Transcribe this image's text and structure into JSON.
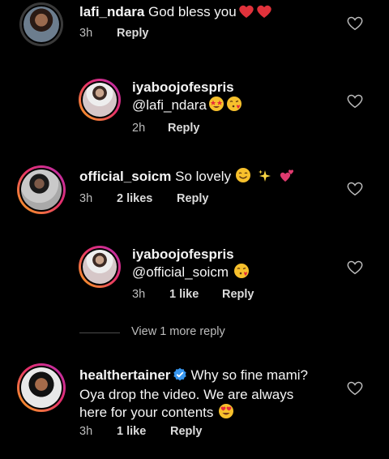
{
  "comments": [
    {
      "username": "lafi_ndara",
      "text": "God bless you",
      "emojis": [
        "red-heart",
        "red-heart"
      ],
      "time": "3h",
      "likes": "",
      "reply_label": "Reply"
    },
    {
      "username": "iyaboojofespris",
      "text": "@lafi_ndara",
      "emojis": [
        "star-struck",
        "face-blowing-kiss"
      ],
      "time": "2h",
      "likes": "",
      "reply_label": "Reply"
    },
    {
      "username": "official_soicm",
      "text": "So lovely",
      "emojis": [
        "smiling-face",
        "sparkles",
        "two-hearts"
      ],
      "time": "3h",
      "likes": "2 likes",
      "reply_label": "Reply"
    },
    {
      "username": "iyaboojofespris",
      "text": "@official_soicm",
      "emojis": [
        "face-blowing-kiss"
      ],
      "time": "3h",
      "likes": "1 like",
      "reply_label": "Reply"
    },
    {
      "username": "healthertainer",
      "text_line1": "Why so fine mami?",
      "text_line2": "Oya drop the video. We are always",
      "text_line3": "here for your contents",
      "emojis": [
        "heart-eyes"
      ],
      "verified": true,
      "time": "3h",
      "likes": "1 like",
      "reply_label": "Reply"
    }
  ],
  "view_more_label": "View 1 more reply",
  "colors": {
    "background": "#000000",
    "text": "#f5f5f5",
    "meta": "#bdbdbd",
    "verified": "#3897f0",
    "story_ring": "#e6306a"
  }
}
